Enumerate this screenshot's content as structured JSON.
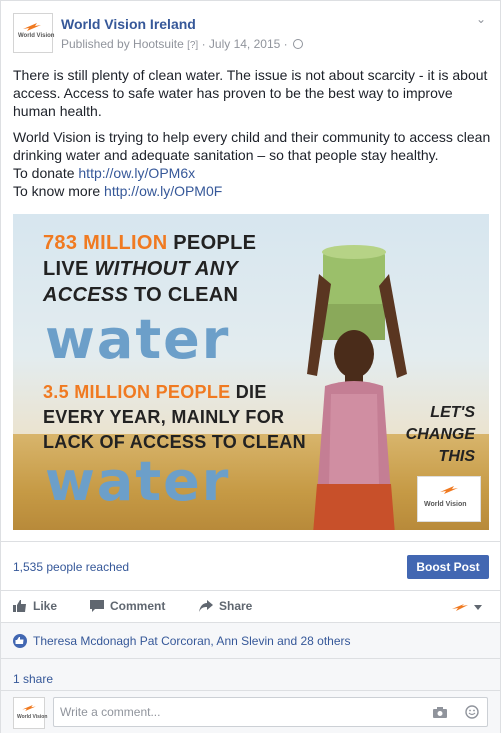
{
  "post": {
    "page_name": "World Vision Ireland",
    "published_by": "Published by Hootsuite",
    "bracket": "[?]",
    "sep1": "·",
    "date": "July 14, 2015",
    "sep2": "·",
    "avatar_text": "World Vision",
    "paragraph1": "There is still plenty of clean water. The issue is not about scarcity - it is about access. Access to safe water has proven to be the best way to improve human health.",
    "paragraph2": "World Vision is trying to help every child and their community to access clean drinking water and adequate sanitation – so that people stay healthy.",
    "donate_label": "To donate",
    "donate_link": "http://ow.ly/OPM6x",
    "more_label": "To know more",
    "more_link": "http://ow.ly/OPM0F"
  },
  "image": {
    "line1_orange": "783 MILLION",
    "line1_dark": "PEOPLE",
    "line2_pre": "LIVE",
    "line2_em": "WITHOUT ANY",
    "line3_em": "ACCESS",
    "line3_post": "TO CLEAN",
    "water1": "water",
    "line4_orange": "3.5 MILLION PEOPLE",
    "line4_dark": "DIE",
    "line5": "EVERY YEAR, MAINLY FOR",
    "line6": "LACK OF ACCESS TO CLEAN",
    "water2": "water",
    "lets": "LET'S",
    "change": "CHANGE",
    "this": "THIS",
    "logo_text": "World Vision"
  },
  "stats": {
    "reached": "1,535 people reached",
    "boost": "Boost Post"
  },
  "actions": {
    "like": "Like",
    "comment": "Comment",
    "share": "Share"
  },
  "social": {
    "likers": "Theresa Mcdonagh Pat Corcoran, Ann Slevin and 28 others",
    "shares": "1 share"
  },
  "comment": {
    "placeholder": "Write a comment...",
    "avatar_text": "World Vision"
  },
  "colors": {
    "brand_blue": "#4267b2",
    "link_blue": "#365899",
    "wv_orange": "#f07a21",
    "water_blue": "#6c9fc9"
  }
}
